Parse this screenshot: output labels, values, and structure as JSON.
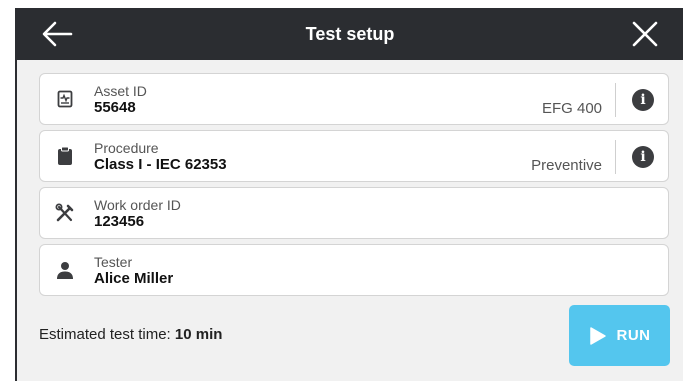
{
  "header": {
    "title": "Test setup",
    "back_icon": "arrow-left-icon",
    "close_icon": "close-icon",
    "background": "#2b2d31"
  },
  "fields": {
    "asset": {
      "icon": "asset-device-icon",
      "label": "Asset ID",
      "value": "55648",
      "model": "EFG 400",
      "info_icon": "info-icon"
    },
    "procedure": {
      "icon": "clipboard-icon",
      "label": "Procedure",
      "value": "Class I - IEC 62353",
      "type": "Preventive",
      "info_icon": "info-icon"
    },
    "work_order": {
      "icon": "tools-icon",
      "label": "Work order ID",
      "value": "123456"
    },
    "tester": {
      "icon": "person-icon",
      "label": "Tester",
      "value": "Alice Miller"
    }
  },
  "footer": {
    "estimate_label": "Estimated test time:",
    "estimate_value": "10 min"
  },
  "run_button": {
    "label": "RUN",
    "icon": "play-icon",
    "color": "#54c6ee"
  }
}
